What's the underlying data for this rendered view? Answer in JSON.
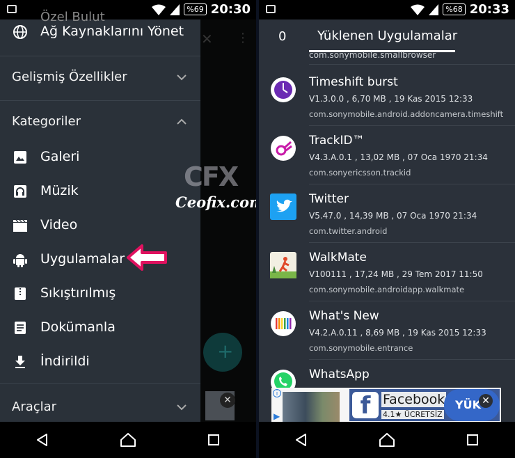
{
  "left": {
    "status": {
      "battery": "%69",
      "time": "20:30"
    },
    "header_cut": "Özel Bulut",
    "drawer": {
      "manage_network": "Ağ Kaynaklarını Yönet",
      "advanced": "Gelişmiş Özellikler",
      "categories": "Kategoriler",
      "items": [
        {
          "label": "Galeri",
          "icon": "image-icon"
        },
        {
          "label": "Müzik",
          "icon": "headphones-icon"
        },
        {
          "label": "Video",
          "icon": "clapperboard-icon"
        },
        {
          "label": "Uygulamalar",
          "icon": "android-icon"
        },
        {
          "label": "Sıkıştırılmış",
          "icon": "archive-icon"
        },
        {
          "label": "Dokümanla",
          "icon": "document-icon"
        },
        {
          "label": "İndirildi",
          "icon": "download-icon"
        }
      ],
      "tools": "Araçlar"
    },
    "watermark": {
      "logo": "CFX",
      "site": "Ceofix.com"
    },
    "arrow_color": "#e0115f"
  },
  "right": {
    "status": {
      "battery": "%68",
      "time": "20:33"
    },
    "tab_count": "0",
    "tab_title": "Yüklenen Uygulamalar",
    "cut_package": "com.sonymobile.smallbrowser",
    "apps": [
      {
        "name": "Timeshift burst",
        "meta": "V1.3.0.0 , 6,70 MB , 19 Kas 2015 12:33",
        "package": "com.sonymobile.android.addoncamera.timeshift"
      },
      {
        "name": "TrackID™",
        "meta": "V4.3.A.0.1 , 13,02 MB , 07 Oca 1970 21:34",
        "package": "com.sonyericsson.trackid"
      },
      {
        "name": "Twitter",
        "meta": "V5.47.0 , 14,39 MB , 07 Oca 1970 21:34",
        "package": "com.twitter.android"
      },
      {
        "name": "WalkMate",
        "meta": "V100111 , 17,24 MB , 29 Tem 2017 11:50",
        "package": "com.sonymobile.androidapp.walkmate"
      },
      {
        "name": "What's New",
        "meta": "V4.2.A.0.11 , 8,69 MB , 19 Kas 2015 12:33",
        "package": "com.sonymobile.entrance"
      },
      {
        "name": "WhatsApp",
        "meta": "",
        "package": ""
      }
    ],
    "ad": {
      "app_name": "Facebook",
      "rating": "4.1★ ÜCRETSİZ",
      "install": "YÜK"
    }
  }
}
